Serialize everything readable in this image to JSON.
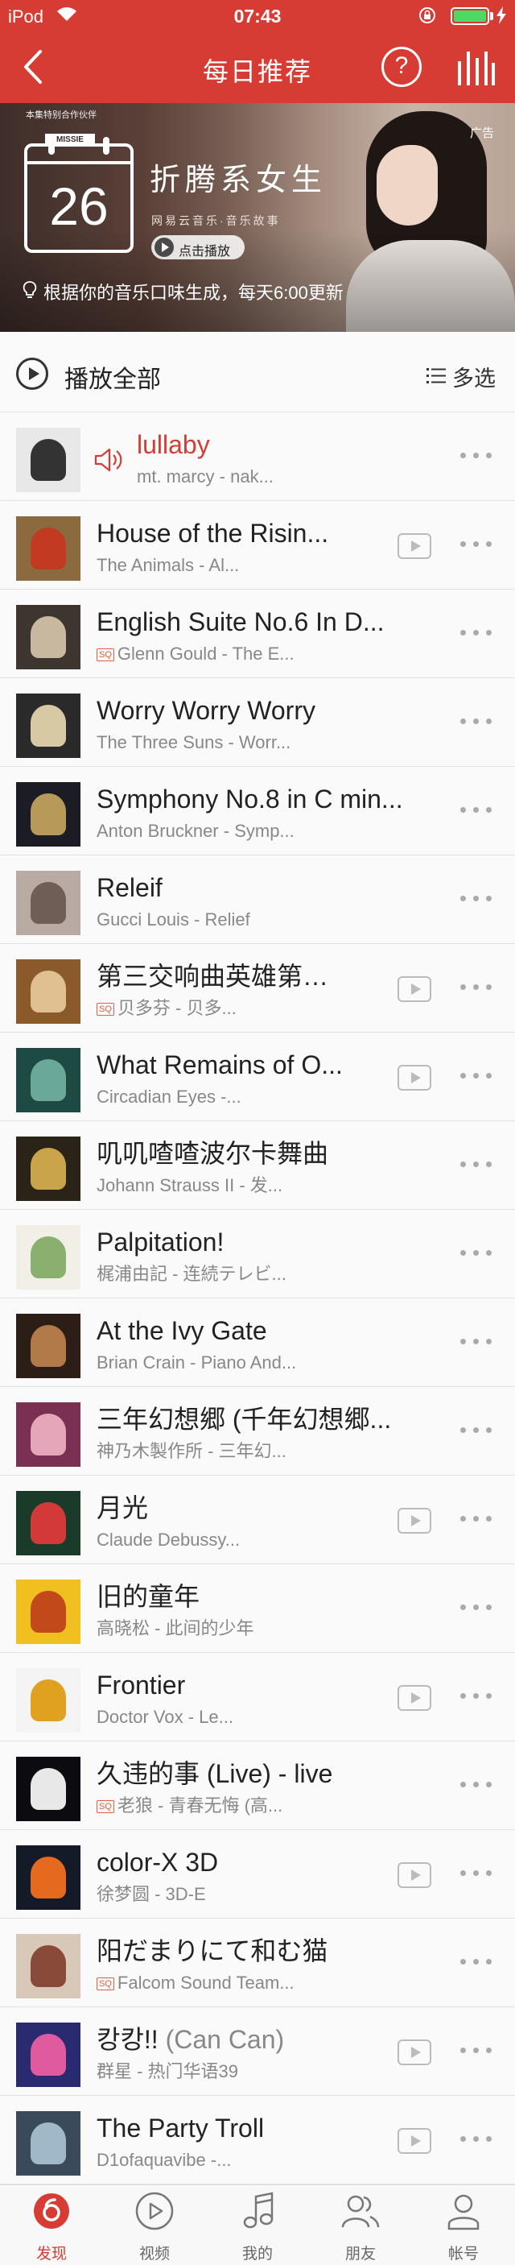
{
  "status": {
    "carrier": "iPod",
    "time": "07:43"
  },
  "nav": {
    "title": "每日推荐",
    "help_label": "?"
  },
  "banner": {
    "partner_text": "本集特别合作伙伴",
    "brand_logo": "MISSIE",
    "day": "26",
    "album_title": "折腾系女生",
    "album_subtitle": "网易云音乐·音乐故事",
    "play_label": "点击播放",
    "ad_tag": "广告",
    "hint": "根据你的音乐口味生成，每天6:00更新"
  },
  "play_all": {
    "label": "播放全部",
    "multi_select": "多选"
  },
  "songs": [
    {
      "title": "lullaby",
      "suffix": "",
      "sub": "mt. marcy - nak...",
      "sq": false,
      "mv": false,
      "playing": true,
      "cover": [
        "#e8e8e8",
        "#333333"
      ]
    },
    {
      "title": "House of the Risin...",
      "suffix": "",
      "sub": "The Animals - Al...",
      "sq": false,
      "mv": true,
      "playing": false,
      "cover": [
        "#8a6a3e",
        "#c23a22"
      ]
    },
    {
      "title": "English Suite No.6 In D...",
      "suffix": "",
      "sub": "Glenn Gould - The E...",
      "sq": true,
      "mv": false,
      "playing": false,
      "cover": [
        "#3d3630",
        "#c8b8a0"
      ]
    },
    {
      "title": "Worry Worry Worry",
      "suffix": "",
      "sub": "The Three Suns - Worr...",
      "sq": false,
      "mv": false,
      "playing": false,
      "cover": [
        "#2a2a2a",
        "#d7c9a4"
      ]
    },
    {
      "title": "Symphony No.8 in C min...",
      "suffix": "",
      "sub": "Anton Bruckner - Symp...",
      "sq": false,
      "mv": false,
      "playing": false,
      "cover": [
        "#1c1c24",
        "#b79a5a"
      ]
    },
    {
      "title": "Releif",
      "suffix": "",
      "sub": "Gucci Louis - Relief",
      "sq": false,
      "mv": false,
      "playing": false,
      "cover": [
        "#b9aba3",
        "#6e5e56"
      ]
    },
    {
      "title": "第三交响曲英雄第…",
      "suffix": "",
      "sub": "贝多芬 - 贝多...",
      "sq": true,
      "mv": true,
      "playing": false,
      "cover": [
        "#8a5a2a",
        "#e0c090"
      ]
    },
    {
      "title": "What Remains of O...",
      "suffix": "",
      "sub": "Circadian Eyes -...",
      "sq": false,
      "mv": true,
      "playing": false,
      "cover": [
        "#1e4a44",
        "#6aa89a"
      ]
    },
    {
      "title": "叽叽喳喳波尔卡舞曲",
      "suffix": "",
      "sub": "Johann Strauss II - 发...",
      "sq": false,
      "mv": false,
      "playing": false,
      "cover": [
        "#2a2418",
        "#c9a44a"
      ]
    },
    {
      "title": "Palpitation!",
      "suffix": "",
      "sub": "梶浦由記 - 连続テレビ...",
      "sq": false,
      "mv": false,
      "playing": false,
      "cover": [
        "#f2f0e6",
        "#8ab070"
      ]
    },
    {
      "title": "At the Ivy Gate",
      "suffix": "",
      "sub": "Brian Crain - Piano And...",
      "sq": false,
      "mv": false,
      "playing": false,
      "cover": [
        "#2c1e16",
        "#b27a48"
      ]
    },
    {
      "title": "三年幻想郷 (千年幻想郷...",
      "suffix": "",
      "sub": "神乃木製作所 - 三年幻...",
      "sq": false,
      "mv": false,
      "playing": false,
      "cover": [
        "#7a3050",
        "#e4a6b8"
      ]
    },
    {
      "title": "月光",
      "suffix": "",
      "sub": "Claude Debussy...",
      "sq": false,
      "mv": true,
      "playing": false,
      "cover": [
        "#1a3a2a",
        "#d23a3a"
      ]
    },
    {
      "title": "旧的童年",
      "suffix": "",
      "sub": "高晓松 - 此间的少年",
      "sq": false,
      "mv": false,
      "playing": false,
      "cover": [
        "#f0c020",
        "#c24a1a"
      ]
    },
    {
      "title": "Frontier",
      "suffix": "",
      "sub": "Doctor Vox - Le...",
      "sq": false,
      "mv": true,
      "playing": false,
      "cover": [
        "#f4f4f4",
        "#e0a020"
      ]
    },
    {
      "title": "久违的事 (Live) - live",
      "suffix": "",
      "sub": "老狼 - 青春无悔 (高...",
      "sq": true,
      "mv": false,
      "playing": false,
      "cover": [
        "#0c0c10",
        "#e8e8e8"
      ]
    },
    {
      "title": "color-X 3D",
      "suffix": "",
      "sub": "徐梦圆 - 3D-E",
      "sq": false,
      "mv": true,
      "playing": false,
      "cover": [
        "#141a28",
        "#e46a20"
      ]
    },
    {
      "title": "阳だまりにて和む猫",
      "suffix": "",
      "sub": "Falcom Sound Team...",
      "sq": true,
      "mv": false,
      "playing": false,
      "cover": [
        "#d8c8b8",
        "#8a4a3a"
      ]
    },
    {
      "title": "캉캉!!",
      "suffix": " (Can Can)",
      "sub": "群星 - 热门华语39",
      "sq": false,
      "mv": true,
      "playing": false,
      "cover": [
        "#2a2a70",
        "#e05aa0"
      ]
    },
    {
      "title": "The Party Troll",
      "suffix": "",
      "sub": "D1ofaquavibe -...",
      "sq": false,
      "mv": true,
      "playing": false,
      "cover": [
        "#3a4a5a",
        "#a0b8c8"
      ]
    }
  ],
  "tabs": [
    {
      "label": "发现",
      "icon": "discover-icon",
      "active": true
    },
    {
      "label": "视频",
      "icon": "video-icon",
      "active": false
    },
    {
      "label": "我的",
      "icon": "music-note-icon",
      "active": false
    },
    {
      "label": "朋友",
      "icon": "friends-icon",
      "active": false
    },
    {
      "label": "帐号",
      "icon": "account-icon",
      "active": false
    }
  ],
  "colors": {
    "brand_red": "#d63c33",
    "battery_green": "#4cd964",
    "sq_badge": "#e55e3b"
  }
}
